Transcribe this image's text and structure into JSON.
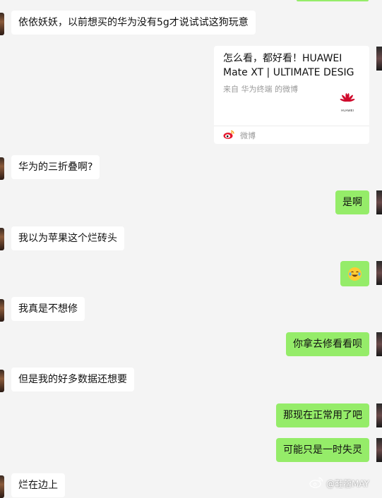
{
  "messages": [
    {
      "side": "in",
      "text": "依依妖妖，以前想买的华为没有5g才说试试这狗玩意"
    },
    {
      "side": "out",
      "type": "card",
      "card": {
        "title": "怎么看，都好看！HUAWEI Mate XT | ULTIMATE DESIG",
        "source": "来自 华为终端 的微博",
        "brand": "HUAWEI",
        "footer": "微博"
      }
    },
    {
      "side": "in",
      "text": "华为的三折叠啊?"
    },
    {
      "side": "out",
      "text": "是啊"
    },
    {
      "side": "in",
      "text": "我以为苹果这个烂砖头"
    },
    {
      "side": "out",
      "type": "emoji",
      "emoji": "laughing-tears"
    },
    {
      "side": "in",
      "text": "我真是不想修"
    },
    {
      "side": "out",
      "text": "你拿去修看看呗"
    },
    {
      "side": "in",
      "text": "但是我的好多数据还想要"
    },
    {
      "side": "out",
      "text": "那现在正常用了吧"
    },
    {
      "side": "out",
      "text": "可能只是一时失灵"
    },
    {
      "side": "in",
      "text": "烂在边上"
    }
  ],
  "watermark": {
    "handle": "@鞋蓿MAY"
  },
  "colors": {
    "background": "#f4f4f4",
    "out_bubble": "#95ec69",
    "in_bubble": "#ffffff",
    "huawei_red": "#cf0a2c",
    "weibo_orange": "#f5a623"
  }
}
